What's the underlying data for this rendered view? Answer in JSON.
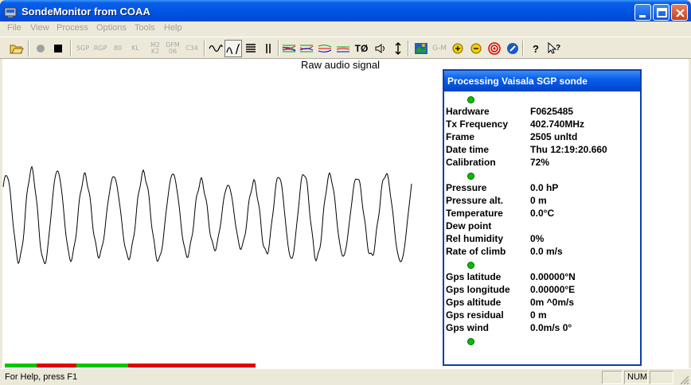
{
  "window": {
    "title": "SondeMonitor from COAA"
  },
  "menu": [
    "File",
    "View",
    "Process",
    "Options",
    "Tools",
    "Help"
  ],
  "toolbar": {
    "labels": {
      "sgp": "SGP",
      "rs80": "80",
      "m2k2": "M2\nK2",
      "dfm": "DFM\n06",
      "c34": "C34",
      "tgo": "TØ"
    }
  },
  "chart": {
    "title": "Raw audio signal"
  },
  "panel": {
    "header": "Processing Vaisala SGP sonde",
    "rows": [
      {
        "label": "Hardware",
        "value": "F0625485"
      },
      {
        "label": "Tx Frequency",
        "value": "402.740MHz"
      },
      {
        "label": "Frame",
        "value": "2505 unltd"
      },
      {
        "label": "Date time",
        "value": "Thu 12:19:20.660"
      },
      {
        "label": "Calibration",
        "value": "72%"
      },
      {
        "label": "Pressure",
        "value": "0.0 hP"
      },
      {
        "label": "Pressure alt.",
        "value": "0 m"
      },
      {
        "label": "Temperature",
        "value": "0.0°C"
      },
      {
        "label": "Dew point",
        "value": ""
      },
      {
        "label": "Rel humidity",
        "value": "0%"
      },
      {
        "label": "Rate of climb",
        "value": "0.0 m/s"
      },
      {
        "label": "Gps latitude",
        "value": "0.00000°N"
      },
      {
        "label": "Gps longitude",
        "value": "0.00000°E"
      },
      {
        "label": "Gps altitude",
        "value": "0m ^0m/s"
      },
      {
        "label": "Gps residual",
        "value": "0 m"
      },
      {
        "label": "Gps wind",
        "value": "0.0m/s 0°"
      }
    ]
  },
  "status": {
    "help_text": "For Help, press F1",
    "num": "NUM"
  },
  "colors": {
    "progress_green": "#00c800",
    "progress_red": "#e00000",
    "led_green": "#00c000"
  }
}
